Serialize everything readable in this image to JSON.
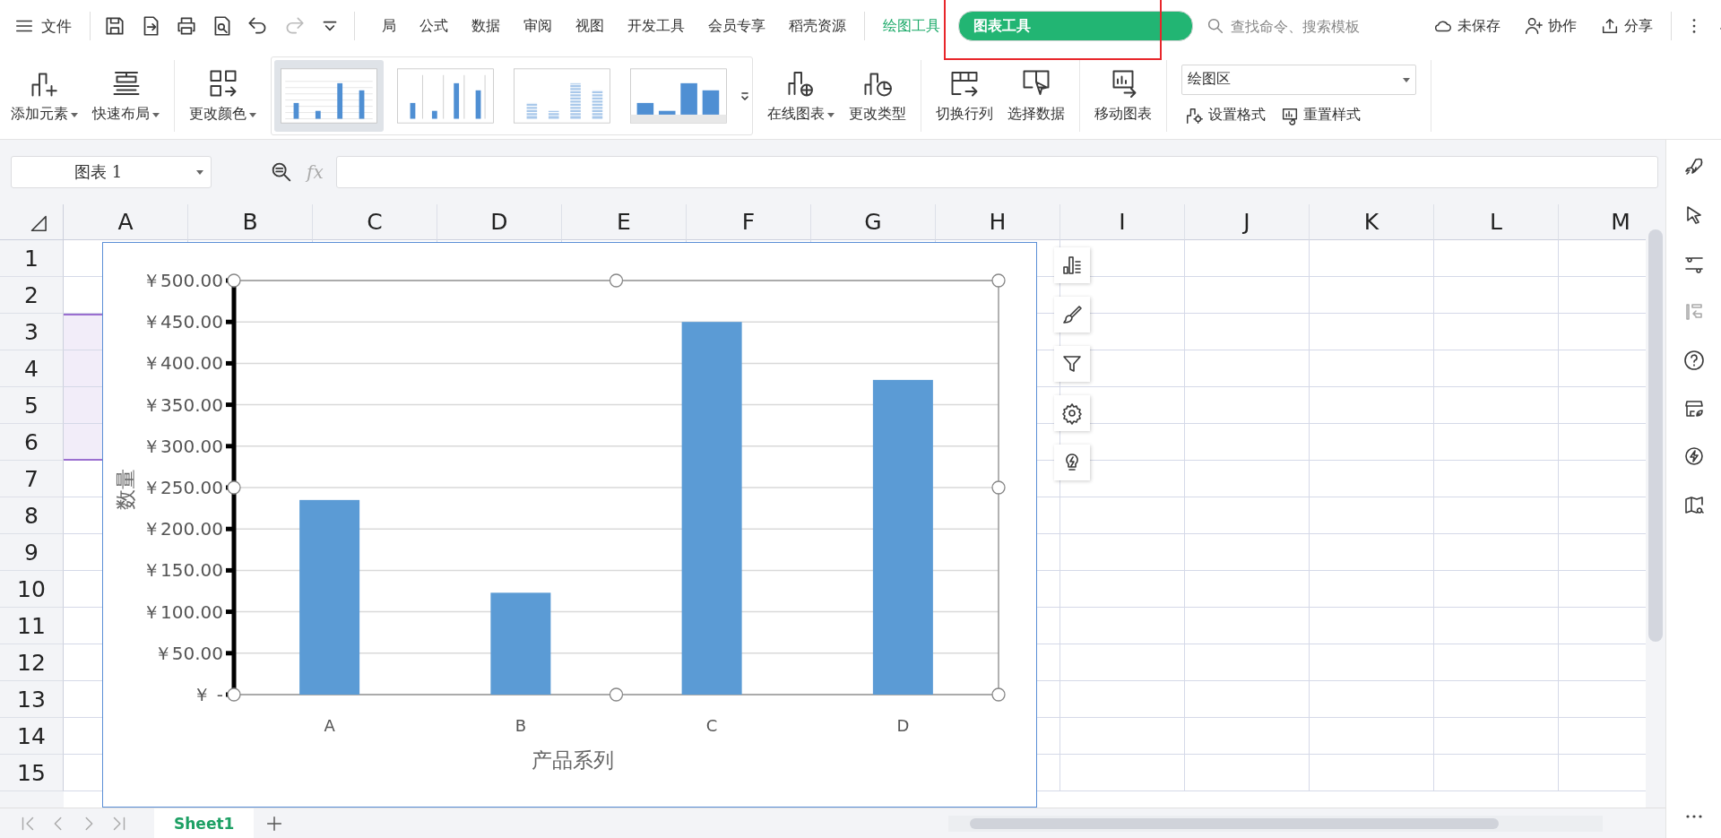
{
  "file_menu": {
    "label": "文件"
  },
  "tabs": [
    {
      "label": "局",
      "selected": false,
      "kind": "normal",
      "highlighted": false
    },
    {
      "label": "公式",
      "selected": false,
      "kind": "normal",
      "highlighted": false
    },
    {
      "label": "数据",
      "selected": false,
      "kind": "normal",
      "highlighted": false
    },
    {
      "label": "审阅",
      "selected": false,
      "kind": "normal",
      "highlighted": false
    },
    {
      "label": "视图",
      "selected": false,
      "kind": "normal",
      "highlighted": false
    },
    {
      "label": "开发工具",
      "selected": false,
      "kind": "normal",
      "highlighted": false
    },
    {
      "label": "会员专享",
      "selected": false,
      "kind": "normal",
      "highlighted": false
    },
    {
      "label": "稻壳资源",
      "selected": false,
      "kind": "normal",
      "highlighted": false
    },
    {
      "label": "绘图工具",
      "selected": false,
      "kind": "context",
      "highlighted": false
    },
    {
      "label": "图表工具",
      "selected": true,
      "kind": "context",
      "highlighted": true
    }
  ],
  "search": {
    "placeholder": "查找命令、搜索模板"
  },
  "header_actions": [
    {
      "label": "未保存",
      "kind": "cloud"
    },
    {
      "label": "协作",
      "kind": "collab"
    },
    {
      "label": "分享",
      "kind": "share"
    }
  ],
  "ribbon": {
    "element_buttons": [
      {
        "label": "添加元素",
        "kind": "add",
        "dropdown": true
      },
      {
        "label": "快速布局",
        "kind": "layout",
        "dropdown": true
      }
    ],
    "color_button": {
      "label": "更改颜色",
      "dropdown": true
    },
    "styles": [
      {
        "kind": "gridlines",
        "selected": true
      },
      {
        "kind": "droplines",
        "selected": false
      },
      {
        "kind": "striped",
        "selected": false
      },
      {
        "kind": "shaded",
        "selected": false
      }
    ],
    "type_buttons": [
      {
        "label": "在线图表",
        "kind": "online",
        "dropdown": true
      },
      {
        "label": "更改类型",
        "kind": "type",
        "dropdown": false
      }
    ],
    "data_buttons": [
      {
        "label": "切换行列",
        "kind": "switch"
      },
      {
        "label": "选择数据",
        "kind": "select"
      }
    ],
    "move_button": {
      "label": "移动图表"
    },
    "element_select": {
      "value": "绘图区"
    },
    "format_buttons": [
      {
        "label": "设置格式",
        "kind": "format"
      },
      {
        "label": "重置样式",
        "kind": "reset"
      }
    ]
  },
  "name_box": {
    "value": "图表 1"
  },
  "formula_bar": {
    "fx": "fx"
  },
  "columns": [
    "A",
    "B",
    "C",
    "D",
    "E",
    "F",
    "G",
    "H",
    "I",
    "J",
    "K",
    "L",
    "M"
  ],
  "rows": [
    {
      "label": "1",
      "selected": false
    },
    {
      "label": "2",
      "selected": false
    },
    {
      "label": "3",
      "selected": true
    },
    {
      "label": "4",
      "selected": true
    },
    {
      "label": "5",
      "selected": true
    },
    {
      "label": "6",
      "selected": true
    },
    {
      "label": "7",
      "selected": false
    },
    {
      "label": "8",
      "selected": false
    },
    {
      "label": "9",
      "selected": false
    },
    {
      "label": "10",
      "selected": false
    },
    {
      "label": "11",
      "selected": false
    },
    {
      "label": "12",
      "selected": false
    },
    {
      "label": "13",
      "selected": false
    },
    {
      "label": "14",
      "selected": false
    },
    {
      "label": "15",
      "selected": false
    }
  ],
  "chart": {
    "chart_data": {
      "type": "bar",
      "xlabel": "产品系列",
      "ylabel": "数量",
      "categories": [
        "A",
        "B",
        "C",
        "D"
      ],
      "grid": true,
      "series": [
        {
          "color": "#5b9bd5",
          "values": [
            235,
            123,
            450,
            380
          ]
        }
      ],
      "ylim": [
        0,
        500
      ],
      "yticks": [
        {
          "value": 0,
          "label": "￥ -"
        },
        {
          "value": 50,
          "label": "￥50.00"
        },
        {
          "value": 100,
          "label": "￥100.00"
        },
        {
          "value": 150,
          "label": "￥150.00"
        },
        {
          "value": 200,
          "label": "￥200.00"
        },
        {
          "value": 250,
          "label": "￥250.00"
        },
        {
          "value": 300,
          "label": "￥300.00"
        },
        {
          "value": 350,
          "label": "￥350.00"
        },
        {
          "value": 400,
          "label": "￥400.00"
        },
        {
          "value": 450,
          "label": "￥450.00"
        },
        {
          "value": 500,
          "label": "￥500.00"
        }
      ]
    }
  },
  "sheet_tabs": [
    {
      "label": "Sheet1",
      "selected": true
    }
  ]
}
